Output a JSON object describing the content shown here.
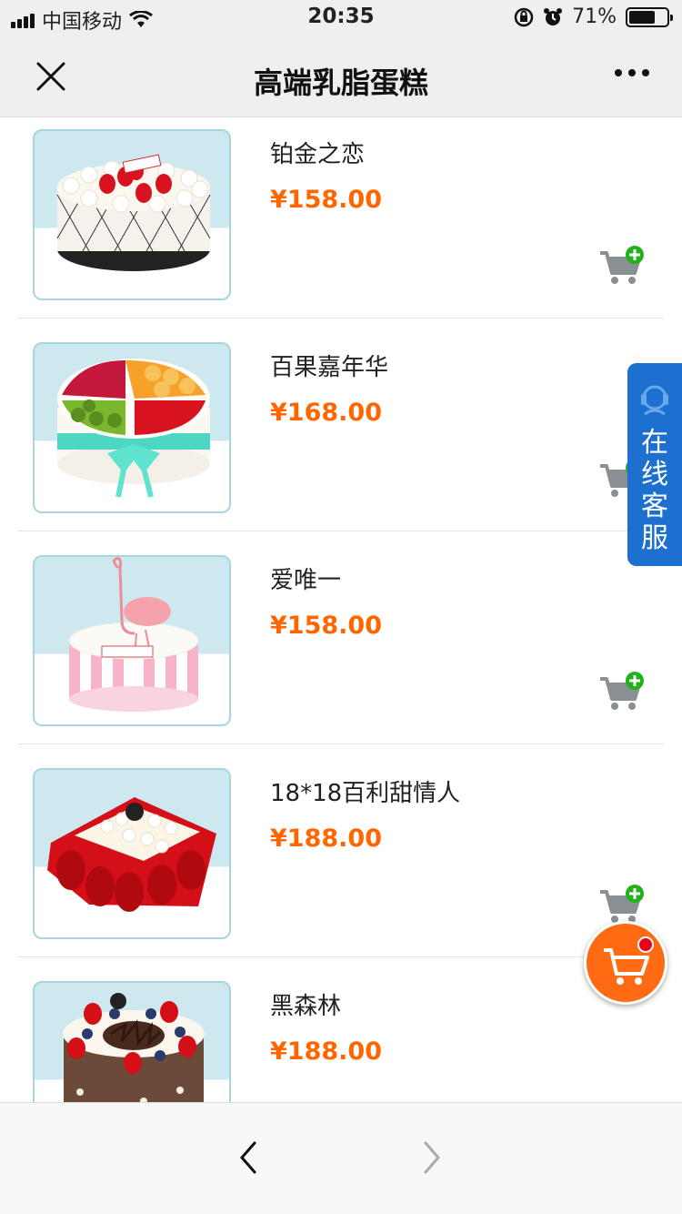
{
  "status_bar": {
    "carrier": "中国移动",
    "time": "20:35",
    "battery_percent": "71%",
    "battery_level": 0.71
  },
  "nav": {
    "title": "高端乳脂蛋糕",
    "close_icon": "close-icon",
    "more_icon": "more-icon"
  },
  "products": [
    {
      "name": "铂金之恋",
      "price": "¥158.00"
    },
    {
      "name": "百果嘉年华",
      "price": "¥168.00"
    },
    {
      "name": "爱唯一",
      "price": "¥158.00"
    },
    {
      "name": "18*18百利甜情人",
      "price": "¥188.00"
    },
    {
      "name": "黑森林",
      "price": "¥188.00"
    }
  ],
  "customer_service": {
    "label_chars": [
      "在",
      "线",
      "客",
      "服"
    ]
  },
  "colors": {
    "price": "#ff6600",
    "cs_tab": "#1d6fd0",
    "float_cart": "#ff6a13",
    "add_badge": "#21b21b"
  }
}
